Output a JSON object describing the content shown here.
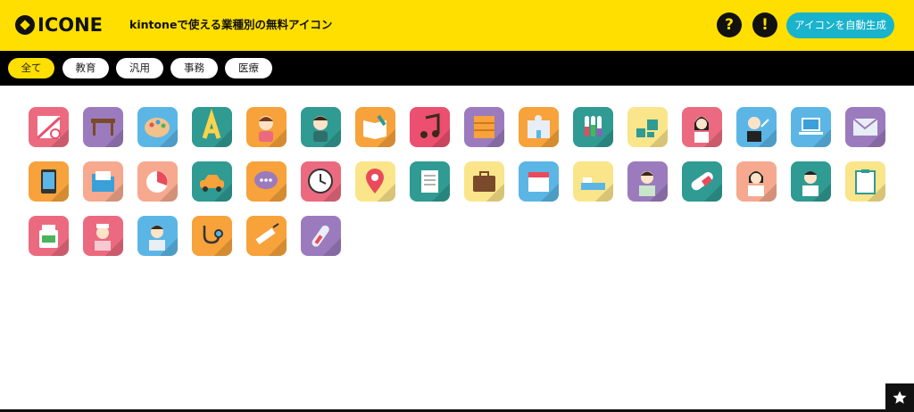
{
  "header": {
    "logo_text": "ICONE",
    "tagline": "kintoneで使える業種別の無料アイコン",
    "help_label": "?",
    "notice_label": "!",
    "generate_label": "アイコンを自動生成"
  },
  "filters": [
    {
      "label": "全て",
      "active": true
    },
    {
      "label": "教育",
      "active": false
    },
    {
      "label": "汎用",
      "active": false
    },
    {
      "label": "事務",
      "active": false
    },
    {
      "label": "医療",
      "active": false
    }
  ],
  "colors": {
    "brand_yellow": "#ffdf00",
    "accent_teal": "#19b3cc",
    "bar_black": "#000000"
  },
  "icons": [
    {
      "name": "geometry-icon",
      "bg": "#ec6a7f"
    },
    {
      "name": "desk-icon",
      "bg": "#9b7bbd"
    },
    {
      "name": "palette-icon",
      "bg": "#5bb6e6"
    },
    {
      "name": "letter-a-icon",
      "bg": "#2f9b93"
    },
    {
      "name": "student-girl-icon",
      "bg": "#f7a23a"
    },
    {
      "name": "student-boy-icon",
      "bg": "#2f9b93"
    },
    {
      "name": "book-pencil-icon",
      "bg": "#f7a23a"
    },
    {
      "name": "music-note-icon",
      "bg": "#ec4f6f"
    },
    {
      "name": "drawers-icon",
      "bg": "#9b7bbd"
    },
    {
      "name": "school-building-icon",
      "bg": "#f7a23a"
    },
    {
      "name": "test-tubes-icon",
      "bg": "#2f9b93"
    },
    {
      "name": "blocks-icon",
      "bg": "#fbe58a"
    },
    {
      "name": "teacher-woman-icon",
      "bg": "#ec6a7f"
    },
    {
      "name": "teacher-man-icon",
      "bg": "#5bb6e6"
    },
    {
      "name": "laptop-icon",
      "bg": "#5bb6e6"
    },
    {
      "name": "envelope-icon",
      "bg": "#9b7bbd"
    },
    {
      "name": "tablet-icon",
      "bg": "#f7a23a"
    },
    {
      "name": "folder-icon",
      "bg": "#f6a98f"
    },
    {
      "name": "pie-chart-icon",
      "bg": "#f6a98f"
    },
    {
      "name": "car-icon",
      "bg": "#2f9b93"
    },
    {
      "name": "chat-bubble-icon",
      "bg": "#f7a23a"
    },
    {
      "name": "clock-icon",
      "bg": "#ec6a7f"
    },
    {
      "name": "map-pin-icon",
      "bg": "#fbe58a"
    },
    {
      "name": "document-icon",
      "bg": "#2f9b93"
    },
    {
      "name": "briefcase-icon",
      "bg": "#fbe58a"
    },
    {
      "name": "calendar-icon",
      "bg": "#5bb6e6"
    },
    {
      "name": "bed-icon",
      "bg": "#fbe58a"
    },
    {
      "name": "patient-icon",
      "bg": "#9b7bbd"
    },
    {
      "name": "capsule-icon",
      "bg": "#2f9b93"
    },
    {
      "name": "doctor-woman-icon",
      "bg": "#f6a98f"
    },
    {
      "name": "doctor-man-icon",
      "bg": "#2f9b93"
    },
    {
      "name": "clipboard-icon",
      "bg": "#fbe58a"
    },
    {
      "name": "medicine-bottle-icon",
      "bg": "#ec6a7f"
    },
    {
      "name": "nurse-icon",
      "bg": "#ec6a7f"
    },
    {
      "name": "patient-man-icon",
      "bg": "#5bb6e6"
    },
    {
      "name": "stethoscope-icon",
      "bg": "#f7a23a"
    },
    {
      "name": "syringe-icon",
      "bg": "#f7a23a"
    },
    {
      "name": "thermometer-icon",
      "bg": "#9b7bbd"
    }
  ]
}
